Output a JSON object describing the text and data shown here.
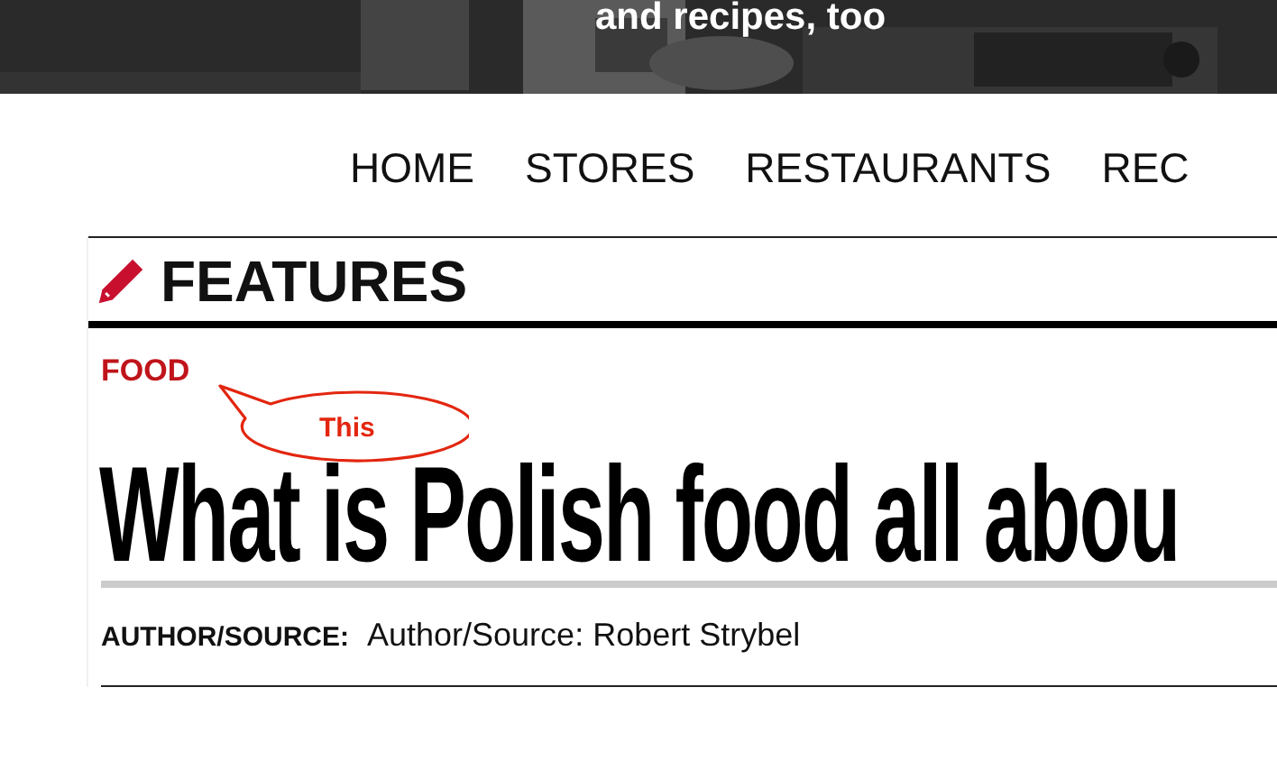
{
  "banner": {
    "tagline": "and recipes, too"
  },
  "nav": [
    {
      "label": "HOME"
    },
    {
      "label": "STORES"
    },
    {
      "label": "RESTAURANTS"
    },
    {
      "label": "REC"
    }
  ],
  "section": {
    "title": "FEATURES"
  },
  "article": {
    "category": "FOOD",
    "headline": "What is Polish food all abou",
    "author_label": "AUTHOR/SOURCE:",
    "author_value": "Author/Source: Robert Strybel"
  },
  "callout": {
    "text": "This"
  }
}
